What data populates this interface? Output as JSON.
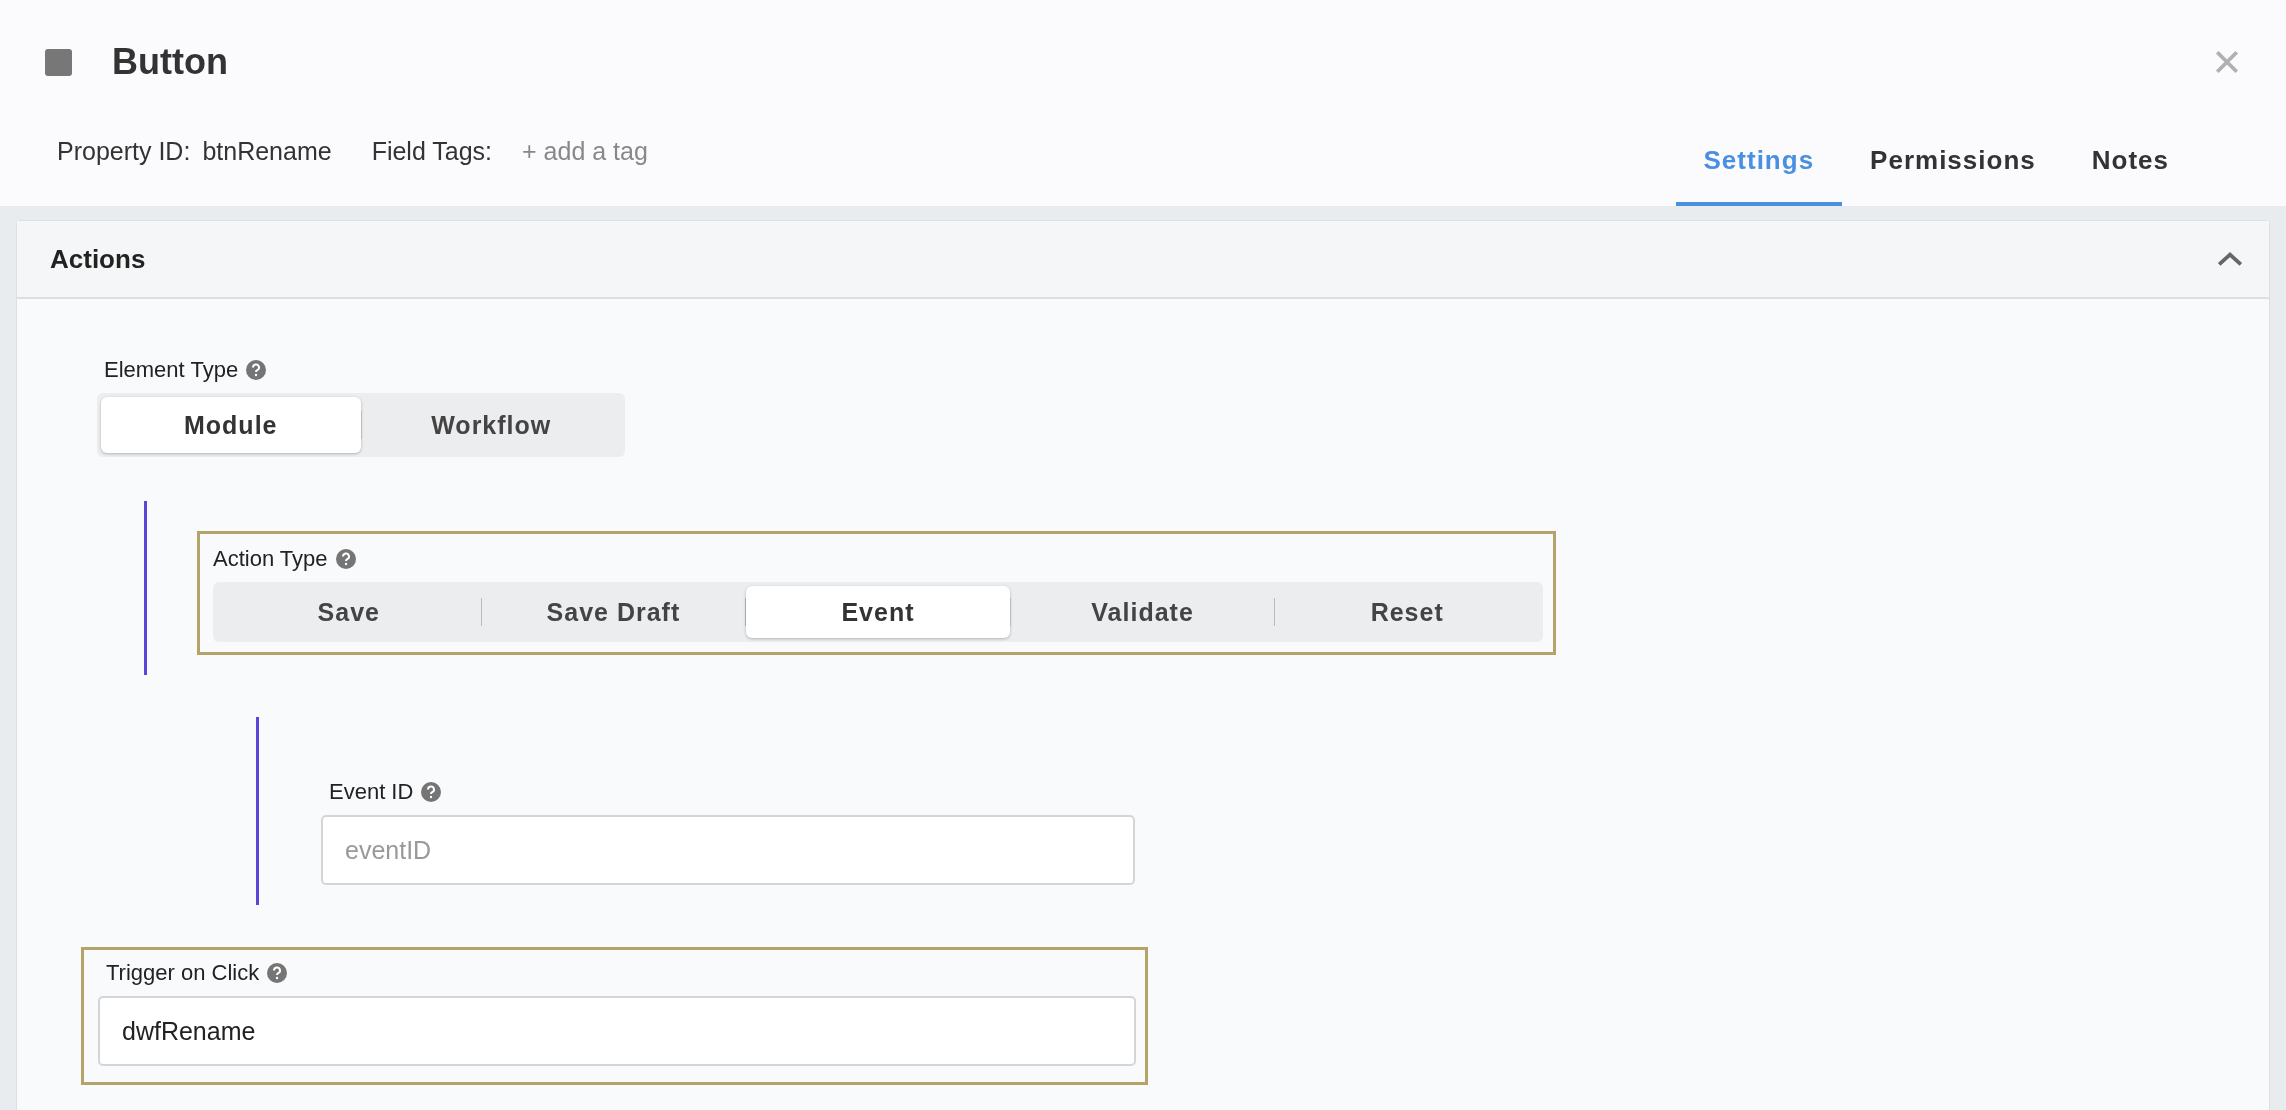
{
  "dialog": {
    "title": "Button",
    "property_id_label": "Property ID:",
    "property_id": "btnRename",
    "field_tags_label": "Field Tags:",
    "add_tag": "+ add a tag",
    "tabs": [
      {
        "label": "Settings",
        "selected": true
      },
      {
        "label": "Permissions",
        "selected": false
      },
      {
        "label": "Notes",
        "selected": false
      }
    ]
  },
  "section": {
    "title": "Actions",
    "expanded": true,
    "element_type": {
      "label": "Element Type",
      "options": [
        {
          "label": "Module",
          "selected": true
        },
        {
          "label": "Workflow",
          "selected": false
        }
      ]
    },
    "action_type": {
      "label": "Action Type",
      "highlighted": true,
      "options": [
        {
          "label": "Save",
          "selected": false
        },
        {
          "label": "Save Draft",
          "selected": false
        },
        {
          "label": "Event",
          "selected": true
        },
        {
          "label": "Validate",
          "selected": false
        },
        {
          "label": "Reset",
          "selected": false
        }
      ]
    },
    "event_id": {
      "label": "Event ID",
      "placeholder": "eventID"
    },
    "trigger_on_click": {
      "label": "Trigger on Click",
      "value": "dwfRename",
      "highlighted": true
    }
  }
}
